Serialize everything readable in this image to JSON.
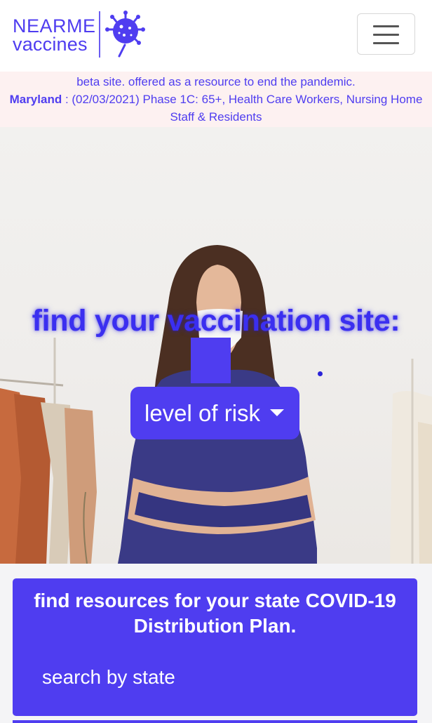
{
  "brand": {
    "logo_line1": "NEARME",
    "logo_line2": "vaccines"
  },
  "navbar": {
    "menu_toggle": "menu-icon"
  },
  "alert": {
    "line1": "beta site. offered as a resource to end the pandemic.",
    "state": "Maryland",
    "message": " : (02/03/2021) Phase 1C: 65+, Health Care Workers, Nursing Home Staff & Residents"
  },
  "hero": {
    "title": "find your vaccination site:",
    "risk_button": "level of risk"
  },
  "resources": {
    "title": "find resources for your state COVID-19 Distribution Plan.",
    "search_placeholder": "search by state"
  },
  "colors": {
    "accent": "#4f3df0",
    "alert_bg": "#fdf1f1"
  }
}
